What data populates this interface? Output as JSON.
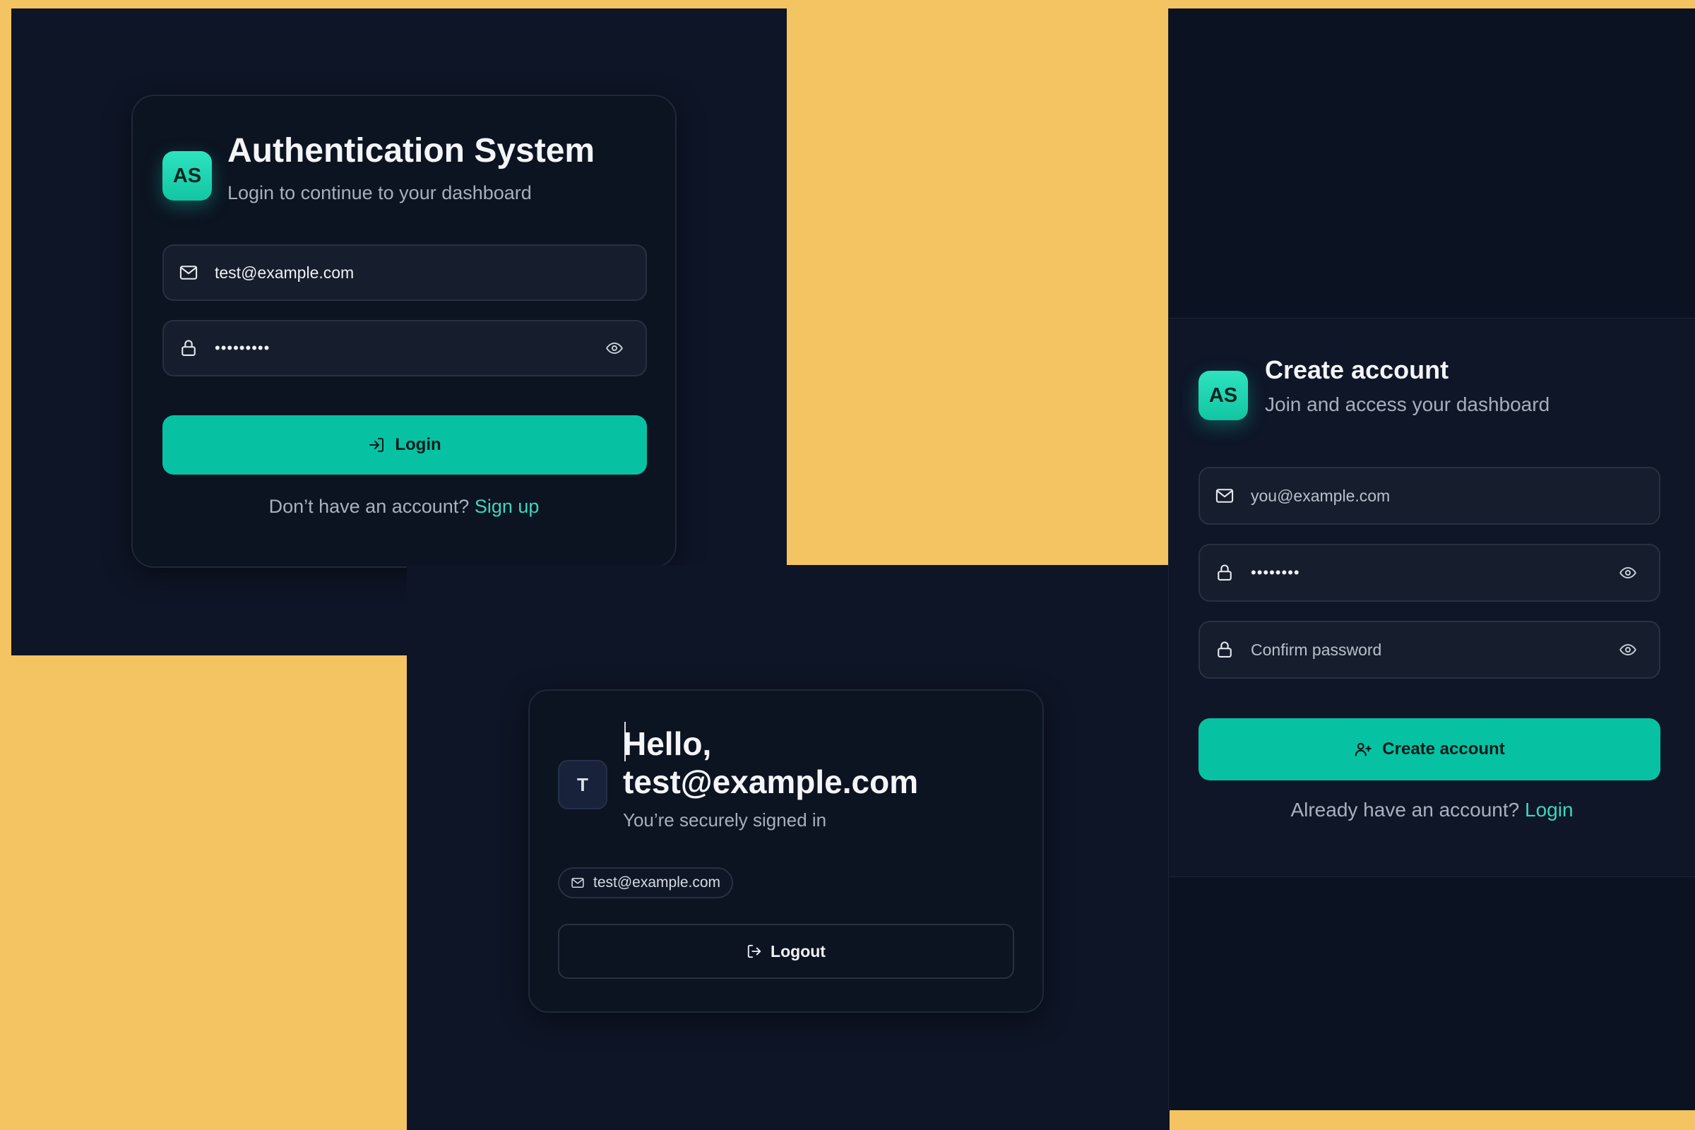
{
  "login": {
    "logo_text": "AS",
    "title": "Authentication System",
    "subtitle": "Login to continue to your dashboard",
    "email_value": "test@example.com",
    "password_value": "•••••••••",
    "submit_label": "Login",
    "footer_text": "Don’t have an account?",
    "footer_link": "Sign up",
    "icons": {
      "email": "mail-icon",
      "password": "lock-icon",
      "reveal": "eye-icon",
      "submit": "log-in-icon"
    }
  },
  "home": {
    "avatar_initial": "T",
    "greeting_line1": "Hello,",
    "greeting_line2": "test@example.com",
    "status": "You’re securely signed in",
    "chip_email": "test@example.com",
    "logout_label": "Logout",
    "icons": {
      "chip": "mail-icon",
      "logout": "log-out-icon"
    }
  },
  "signup": {
    "logo_text": "AS",
    "title": "Create account",
    "subtitle": "Join and access your dashboard",
    "email_placeholder": "you@example.com",
    "password_value": "••••••••",
    "confirm_placeholder": "Confirm password",
    "submit_label": "Create account",
    "footer_text": "Already have an account?",
    "footer_link": "Login",
    "icons": {
      "email": "mail-icon",
      "password": "lock-icon",
      "reveal": "eye-icon",
      "submit": "user-plus-icon"
    }
  },
  "colors": {
    "page_background": "#F4C362",
    "panel_background": "#0E1526",
    "accent": "#06C2A3",
    "link": "#3CD6BF"
  }
}
